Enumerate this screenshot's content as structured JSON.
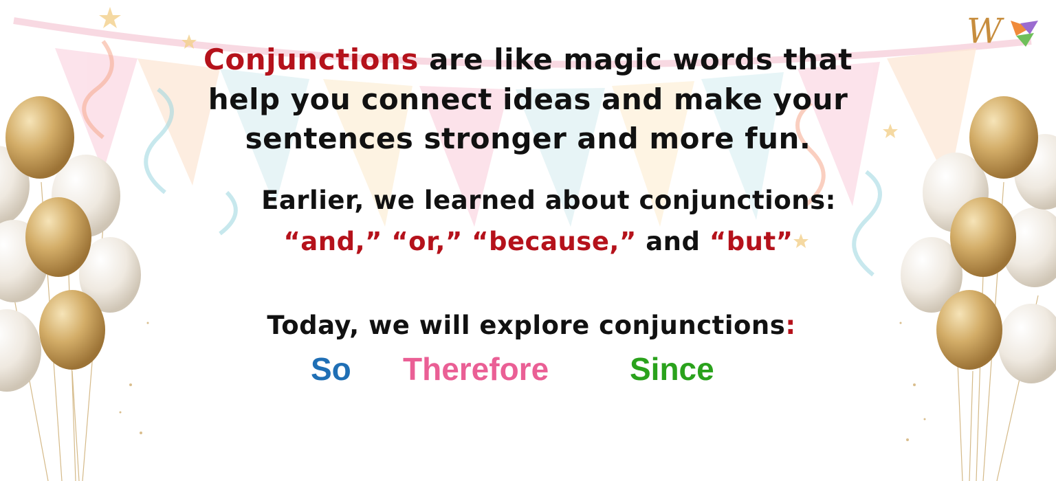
{
  "intro": {
    "highlight": "Conjunctions",
    "line1_rest": "are like magic words that",
    "line2": "help you connect ideas and make your",
    "line3": "sentences stronger and more fun."
  },
  "earlier": {
    "line1": "Earlier, we learned about conjunctions:",
    "word_and": "“and,”",
    "word_or": "“or,”",
    "word_because": "“because,”",
    "joiner": "and",
    "word_but": "“but”"
  },
  "today": {
    "text": "Today, we will explore conjunctions",
    "colon": ":"
  },
  "new_words": [
    {
      "label": "So",
      "color": "#1f6fb5"
    },
    {
      "label": "Therefore",
      "color": "#ea5f95"
    },
    {
      "label": "Since",
      "color": "#2aa21c"
    }
  ],
  "logo": {
    "letter": "W",
    "icon": "w-logo-icon"
  },
  "colors": {
    "highlight_red": "#b5121b",
    "balloon_gold": "#c9a35e",
    "balloon_pearl": "#ece7de",
    "bunting_pink": "#fbd9e4",
    "bunting_blue": "#dff1f4",
    "bunting_cream": "#fdf0d9"
  }
}
